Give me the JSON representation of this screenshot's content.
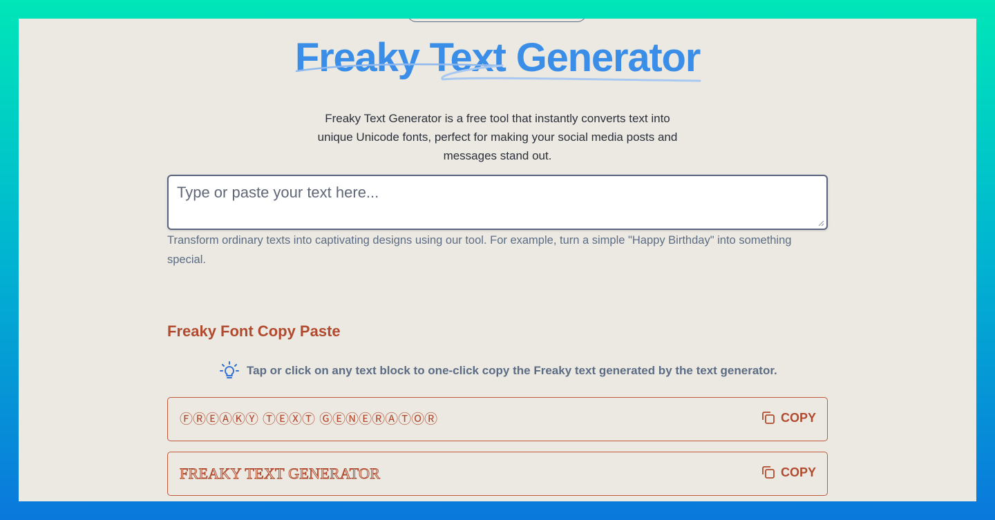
{
  "page": {
    "title": "Freaky Text Generator",
    "description": "Freaky Text Generator is a free tool that instantly converts text into unique Unicode fonts, perfect for making your social media posts and messages stand out."
  },
  "input": {
    "placeholder": "Type or paste your text here...",
    "value": "",
    "helper": "Transform ordinary texts into captivating designs using our tool. For example, turn a simple \"Happy Birthday\" into something special."
  },
  "section": {
    "title": "Freaky Font Copy Paste",
    "tip": "Tap or click on any text block to one-click copy the Freaky text generated by the text generator."
  },
  "results": [
    {
      "text": "ⒻⓇⒺⒶⓀⓎ ⓉⒺⓍⓉ ⒼⒺⓃⒺⓇⒶⓉⓄⓇ",
      "copy_label": "COPY"
    },
    {
      "text": "FREAKY TEXT GENERATOR",
      "copy_label": "COPY"
    }
  ],
  "colors": {
    "accent_blue": "#3a8ee8",
    "accent_rust": "#b14a2e",
    "page_bg": "#ebe9e1"
  },
  "icons": {
    "tip": "lightbulb-icon",
    "copy": "copy-icon"
  }
}
